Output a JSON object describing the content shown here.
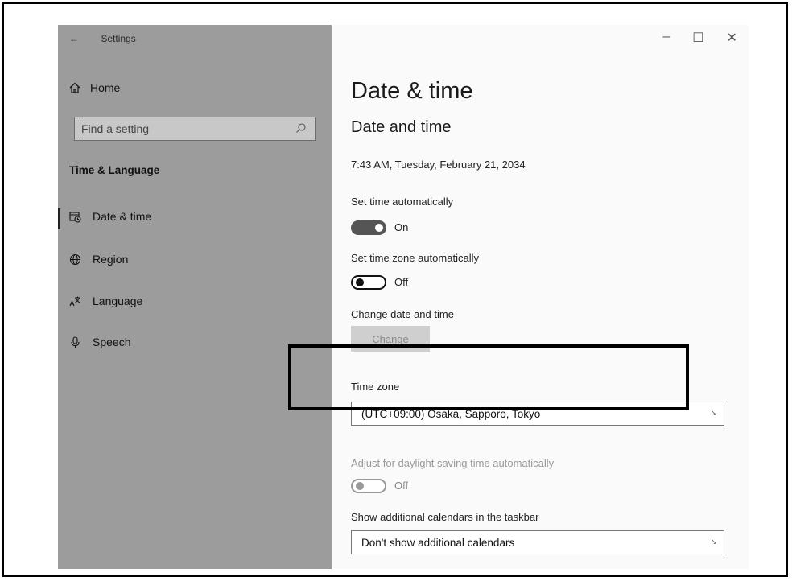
{
  "titlebar": {
    "back_glyph": "←",
    "app_name": "Settings"
  },
  "window_controls": {
    "minimize": "–",
    "maximize": "☐",
    "close": "✕"
  },
  "sidebar": {
    "home": "Home",
    "search_placeholder": "Find a setting",
    "section": "Time & Language",
    "items": [
      {
        "label": "Date & time",
        "icon": "calendar-clock-icon",
        "active": true
      },
      {
        "label": "Region",
        "icon": "globe-icon"
      },
      {
        "label": "Language",
        "icon": "language-icon"
      },
      {
        "label": "Speech",
        "icon": "microphone-icon"
      }
    ]
  },
  "main": {
    "page_title": "Date & time",
    "section_title": "Date and time",
    "current_datetime": "7:43 AM, Tuesday, February 21, 2034",
    "set_time_auto": {
      "label": "Set time automatically",
      "state": "On"
    },
    "set_timezone_auto": {
      "label": "Set time zone automatically",
      "state": "Off"
    },
    "change_datetime": {
      "label": "Change date and time",
      "button": "Change"
    },
    "time_zone": {
      "label": "Time zone",
      "value": "(UTC+09:00) Osaka, Sapporo, Tokyo"
    },
    "daylight_saving": {
      "label": "Adjust for daylight saving time automatically",
      "state": "Off"
    },
    "additional_calendars": {
      "label": "Show additional calendars in the taskbar",
      "value": "Don't show additional calendars"
    }
  }
}
